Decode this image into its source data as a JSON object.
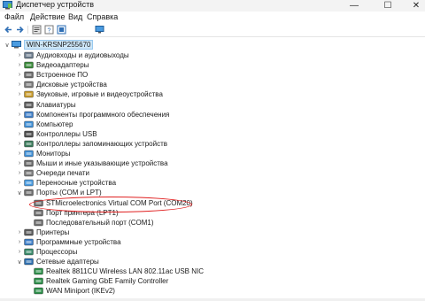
{
  "window": {
    "title": "Диспетчер устройств",
    "minimize": "—",
    "maximize": "☐",
    "close": "✕"
  },
  "menu": [
    "Файл",
    "Действие",
    "Вид",
    "Справка"
  ],
  "toolbar": [
    "back-icon",
    "forward-icon",
    "properties-icon",
    "help-icon",
    "scan-icon",
    "monitor-icon"
  ],
  "tree": {
    "root": "WIN-KRSNP255670",
    "items": [
      {
        "label": "Аудиовходы и аудиовыходы",
        "icon": "audio-icon",
        "level": 1,
        "state": "collapsed"
      },
      {
        "label": "Видеоадаптеры",
        "icon": "display-adapter-icon",
        "level": 1,
        "state": "collapsed"
      },
      {
        "label": "Встроенное ПО",
        "icon": "firmware-icon",
        "level": 1,
        "state": "collapsed"
      },
      {
        "label": "Дисковые устройства",
        "icon": "disk-icon",
        "level": 1,
        "state": "collapsed"
      },
      {
        "label": "Звуковые, игровые и видеоустройства",
        "icon": "sound-icon",
        "level": 1,
        "state": "collapsed"
      },
      {
        "label": "Клавиатуры",
        "icon": "keyboard-icon",
        "level": 1,
        "state": "collapsed"
      },
      {
        "label": "Компоненты программного обеспечения",
        "icon": "software-component-icon",
        "level": 1,
        "state": "collapsed"
      },
      {
        "label": "Компьютер",
        "icon": "computer-icon",
        "level": 1,
        "state": "collapsed"
      },
      {
        "label": "Контроллеры USB",
        "icon": "usb-icon",
        "level": 1,
        "state": "collapsed"
      },
      {
        "label": "Контроллеры запоминающих устройств",
        "icon": "storage-controller-icon",
        "level": 1,
        "state": "collapsed"
      },
      {
        "label": "Мониторы",
        "icon": "monitor-icon",
        "level": 1,
        "state": "collapsed"
      },
      {
        "label": "Мыши и иные указывающие устройства",
        "icon": "mouse-icon",
        "level": 1,
        "state": "collapsed"
      },
      {
        "label": "Очереди печати",
        "icon": "print-queue-icon",
        "level": 1,
        "state": "collapsed"
      },
      {
        "label": "Переносные устройства",
        "icon": "portable-device-icon",
        "level": 1,
        "state": "collapsed"
      },
      {
        "label": "Порты (COM и LPT)",
        "icon": "port-icon",
        "level": 1,
        "state": "expanded"
      },
      {
        "label": "STMicroelectronics Virtual COM Port (COM20)",
        "icon": "port-device-icon",
        "level": 2,
        "state": "none"
      },
      {
        "label": "Порт принтера (LPT1)",
        "icon": "port-device-icon",
        "level": 2,
        "state": "none"
      },
      {
        "label": "Последовательный порт (COM1)",
        "icon": "port-device-icon",
        "level": 2,
        "state": "none"
      },
      {
        "label": "Принтеры",
        "icon": "printer-icon",
        "level": 1,
        "state": "collapsed"
      },
      {
        "label": "Программные устройства",
        "icon": "software-device-icon",
        "level": 1,
        "state": "collapsed"
      },
      {
        "label": "Процессоры",
        "icon": "processor-icon",
        "level": 1,
        "state": "collapsed"
      },
      {
        "label": "Сетевые адаптеры",
        "icon": "network-adapter-icon",
        "level": 1,
        "state": "expanded"
      },
      {
        "label": "Realtek 8811CU Wireless LAN 802.11ac USB NIC",
        "icon": "network-card-icon",
        "level": 2,
        "state": "none"
      },
      {
        "label": "Realtek Gaming GbE Family Controller",
        "icon": "network-card-icon",
        "level": 2,
        "state": "none"
      },
      {
        "label": "WAN Miniport (IKEv2)",
        "icon": "network-card-icon",
        "level": 2,
        "state": "none"
      }
    ]
  },
  "colors": {
    "accent": "#0067c0",
    "selection": "#cde6f7",
    "annotation": "#e02020"
  }
}
